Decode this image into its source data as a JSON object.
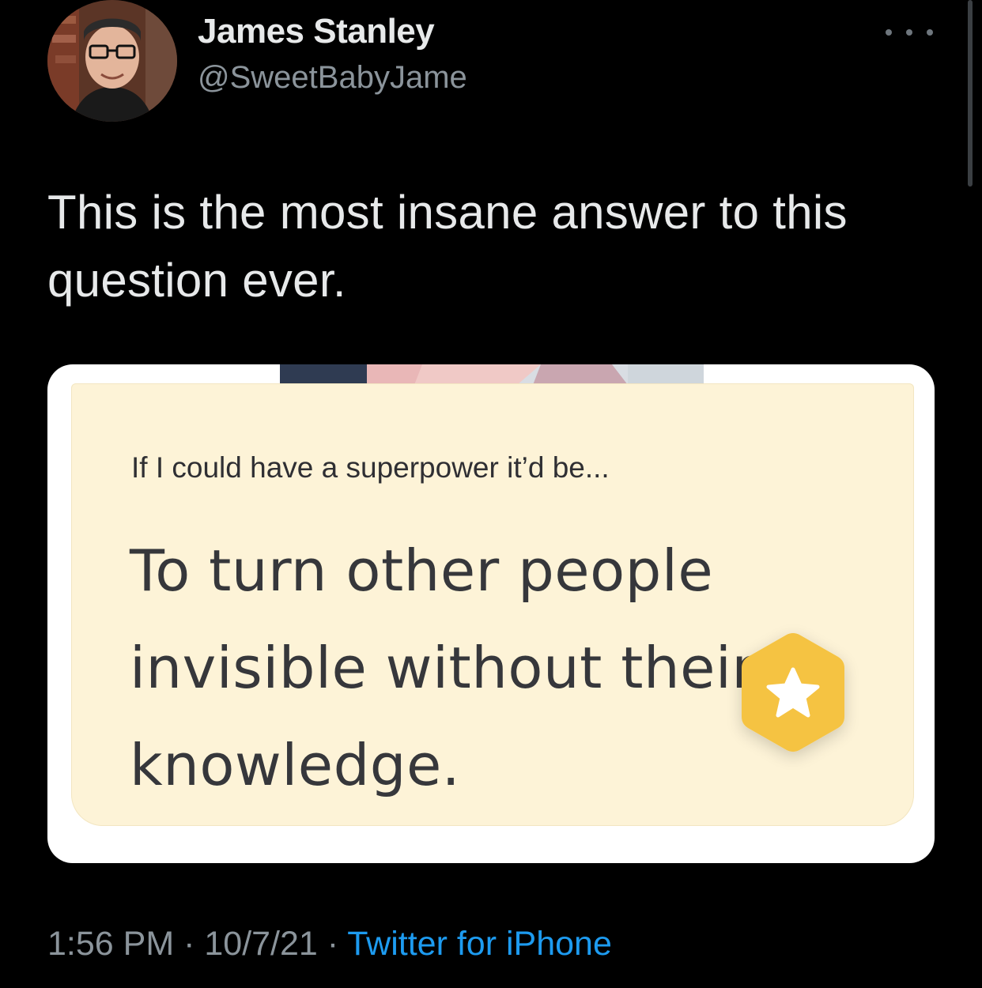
{
  "author": {
    "display_name": "James Stanley",
    "handle": "@SweetBabyJame"
  },
  "tweet": {
    "text": "This is the most insane answer to this question ever."
  },
  "media": {
    "prompt_question": "If I could have a superpower it’d be...",
    "prompt_answer": "To turn other people invisible without their knowledge.",
    "badge_icon": "star-icon",
    "badge_color": "#f5c342",
    "card_color": "#fdf3d7"
  },
  "footer": {
    "time": "1:56 PM",
    "separator": " · ",
    "date": "10/7/21",
    "source": "Twitter for iPhone",
    "source_color": "#1d9bf0"
  },
  "icons": {
    "more": "more-horizontal-icon"
  }
}
